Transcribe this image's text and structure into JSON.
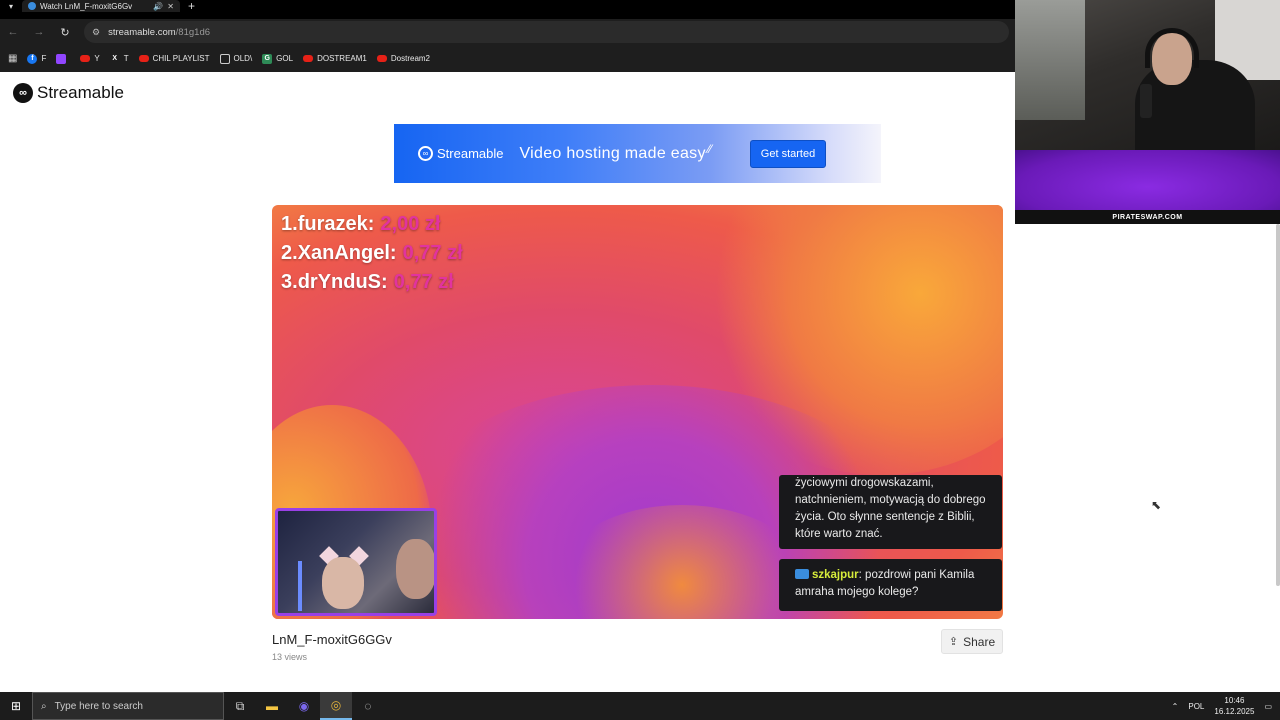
{
  "browser": {
    "tab_title": "Watch LnM_F-moxitG6Gv",
    "url_host": "streamable.com",
    "url_path": "/81g1d6",
    "bookmarks": [
      "F",
      "",
      "Y",
      "T",
      "CHIL PLAYLIST",
      "OLD\\",
      "GOL",
      "DOSTREAM1",
      "Dostream2"
    ]
  },
  "site": {
    "logo_text": "Streamable"
  },
  "ad": {
    "brand": "Streamable",
    "tagline": "Video hosting made easy",
    "cta": "Get started"
  },
  "video": {
    "leaderboard": [
      {
        "rank": "1.",
        "name": "furazek:",
        "amount": "2,00 zł"
      },
      {
        "rank": "2.",
        "name": "XanAngel:",
        "amount": "0,77 zł"
      },
      {
        "rank": "3.",
        "name": "drYnduS:",
        "amount": "0,77 zł"
      }
    ],
    "chat_message_1": "życiowymi drogowskazami, natchnieniem, motywacją do dobrego życia. Oto słynne sentencje z Biblii, które warto znać.",
    "chat_user_2": "szkajpur",
    "chat_message_2": ": pozdrowi pani Kamila amraha mojego kolege?",
    "title": "LnM_F-moxitG6GGv",
    "views": "13 views",
    "share_label": "Share"
  },
  "overlay": {
    "banner_text": "PIRATESWAP.COM"
  },
  "taskbar": {
    "search_placeholder": "Type here to search",
    "language": "POL",
    "time": "10:46",
    "date": "16.12.2025"
  },
  "colors": {
    "brand_blue": "#1665f2",
    "leaderboard_amount": "#e1339f",
    "chat_user": "#d7ec3b"
  }
}
